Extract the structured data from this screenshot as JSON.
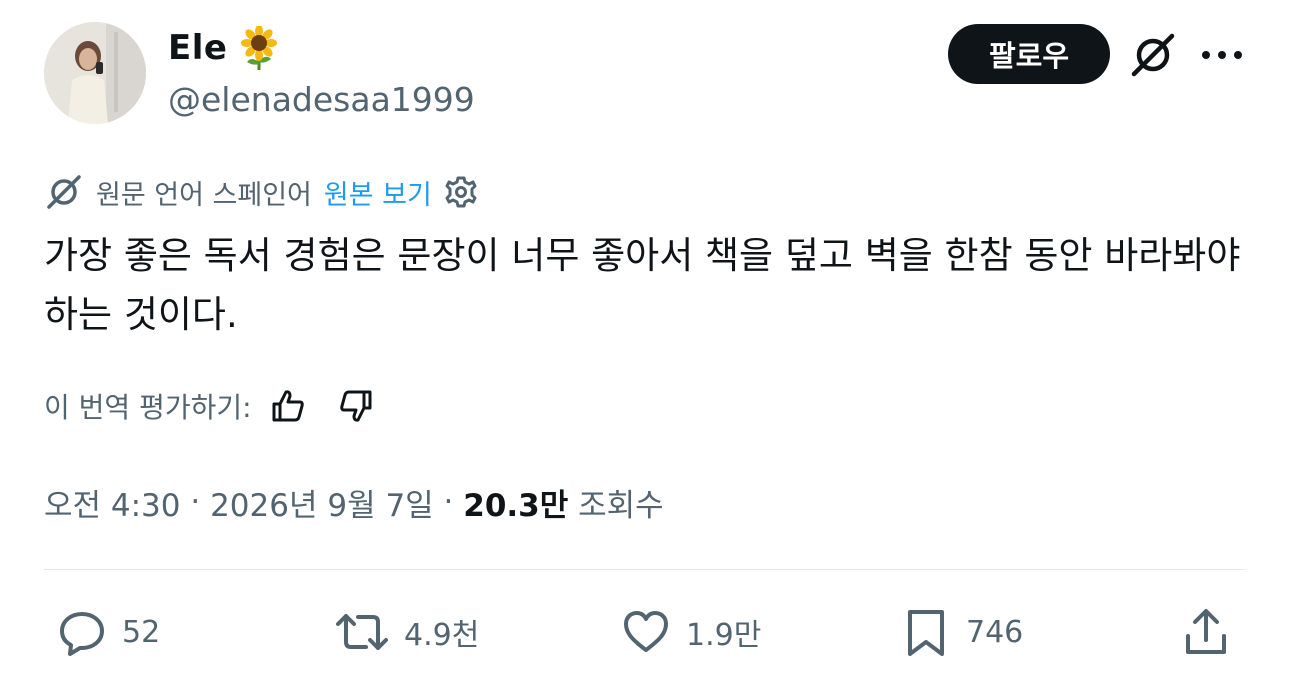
{
  "author": {
    "display_name": "Ele",
    "name_emoji": "sunflower-icon",
    "handle": "@elenadesaa1999"
  },
  "header": {
    "follow_label": "팔로우",
    "grok_icon": "grok-icon",
    "more_icon": "more-dots-icon"
  },
  "translation": {
    "source_label": "원문 언어 스페인어",
    "view_original": "원본 보기",
    "settings_icon": "gear-icon"
  },
  "tweet": {
    "text": "가장 좋은 독서 경험은 문장이 너무 좋아서 책을 덮고 벽을 한참 동안 바라봐야 하는 것이다."
  },
  "rating": {
    "label": "이 번역 평가하기:"
  },
  "meta": {
    "time": "오전 4:30",
    "separator": " · ",
    "date": "2026년 9월 7일",
    "views_count": "20.3만",
    "views_label": "조회수"
  },
  "actions": {
    "replies": "52",
    "reposts": "4.9천",
    "likes": "1.9만",
    "bookmarks": "746"
  },
  "colors": {
    "text": "#0f1419",
    "secondary": "#536471",
    "link": "#1d9bf0",
    "divider": "#e6e9ec"
  }
}
